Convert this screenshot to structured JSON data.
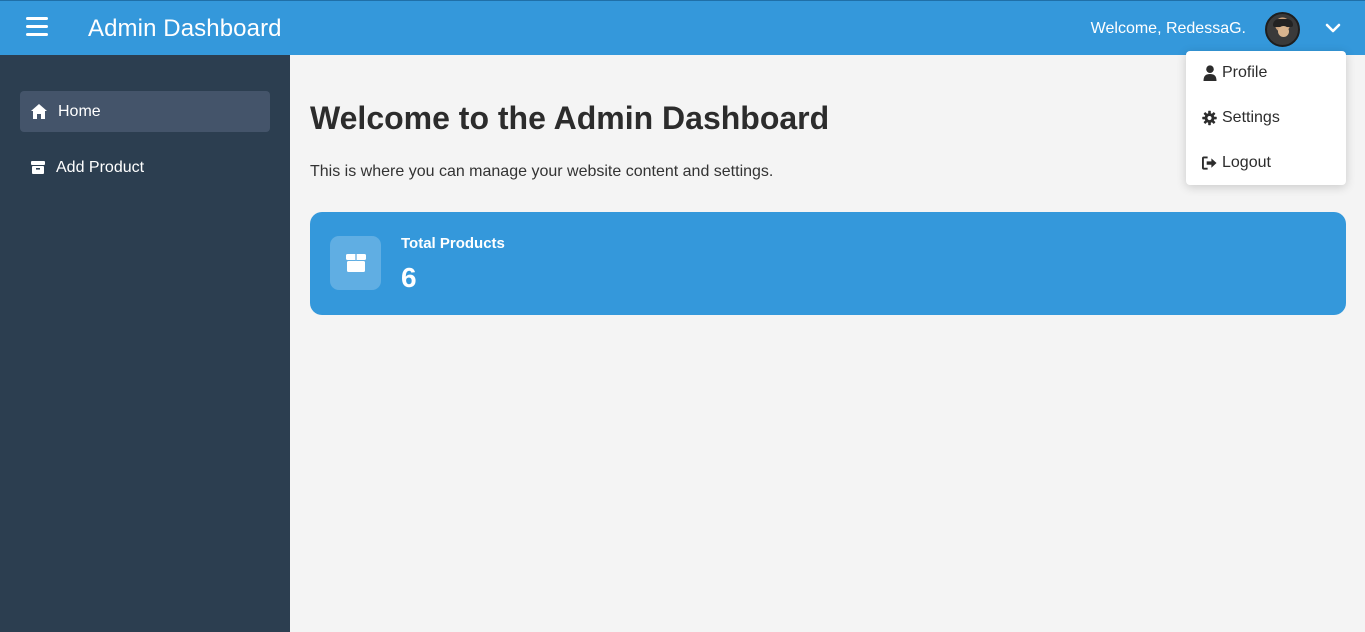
{
  "header": {
    "title": "Admin Dashboard",
    "welcome": "Welcome, RedessaG.",
    "menu_icon": "hamburger-menu-icon",
    "avatar": "user-avatar",
    "dropdown_icon": "chevron-down-icon"
  },
  "sidebar": {
    "items": [
      {
        "label": "Home",
        "icon": "home-icon",
        "active": true
      },
      {
        "label": "Add Product",
        "icon": "box-icon",
        "active": false
      }
    ]
  },
  "main": {
    "title": "Welcome to the Admin Dashboard",
    "description": "This is where you can manage your website content and settings.",
    "stat": {
      "label": "Total Products",
      "value": "6",
      "icon": "box-icon"
    }
  },
  "user_menu": {
    "items": [
      {
        "label": "Profile",
        "icon": "user-icon"
      },
      {
        "label": "Settings",
        "icon": "gear-icon"
      },
      {
        "label": "Logout",
        "icon": "logout-icon"
      }
    ]
  },
  "colors": {
    "primary": "#3498db",
    "sidebar": "#2c3e50",
    "sidebar_active": "#44546a",
    "background": "#f4f4f4"
  }
}
